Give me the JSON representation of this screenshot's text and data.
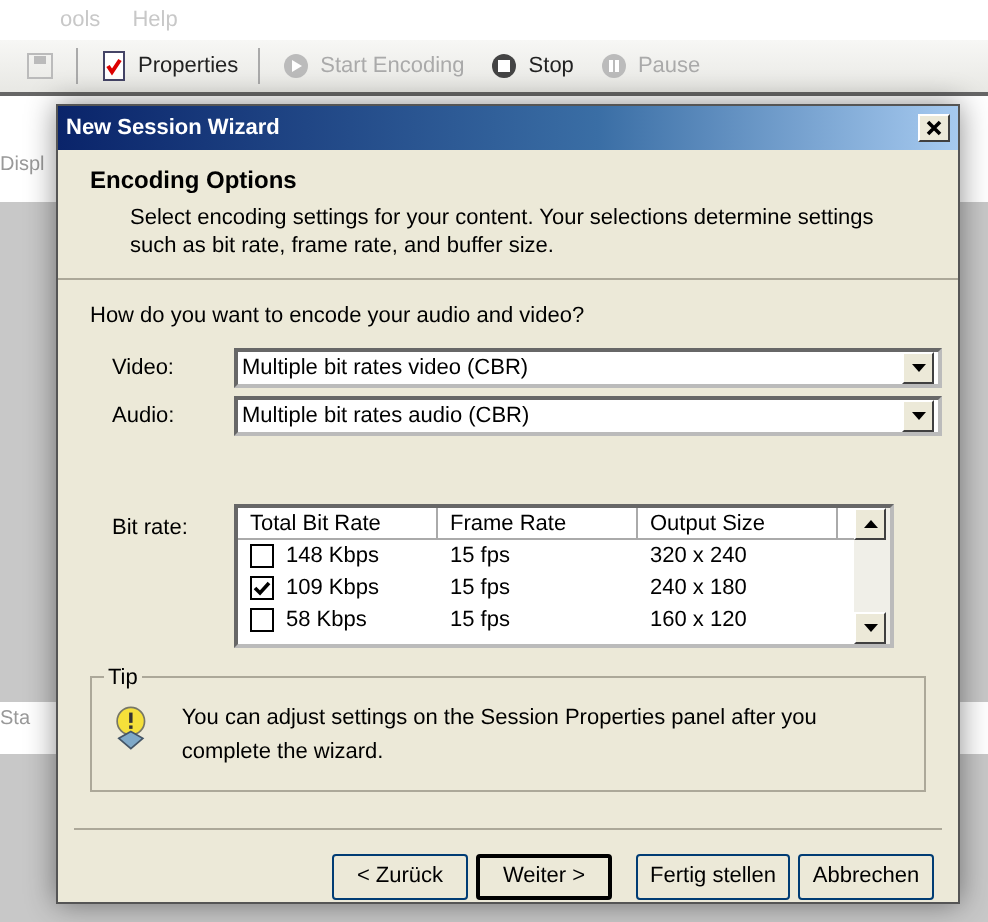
{
  "app": {
    "menu": [
      "ools",
      "Help"
    ],
    "toolbar": [
      {
        "kind": "save",
        "disabled": true
      },
      {
        "kind": "properties",
        "label": "Properties",
        "disabled": false
      },
      {
        "kind": "start",
        "label": "Start Encoding",
        "disabled": true
      },
      {
        "kind": "stop",
        "label": "Stop",
        "disabled": false
      },
      {
        "kind": "pause",
        "label": "Pause",
        "disabled": true
      }
    ],
    "side_labels": [
      "Displ",
      "Sta"
    ]
  },
  "dialog": {
    "title": "New Session Wizard",
    "header": {
      "title": "Encoding Options",
      "description": "Select encoding settings for your content. Your selections determine settings such as bit rate, frame rate, and buffer size."
    },
    "question": "How do you want to encode your audio and video?",
    "fields": [
      {
        "label": "Video:",
        "value": "Multiple bit rates video (CBR)"
      },
      {
        "label": "Audio:",
        "value": "Multiple bit rates audio (CBR)"
      }
    ],
    "bit_rate": {
      "label": "Bit rate:",
      "columns": [
        "Total Bit Rate",
        "Frame Rate",
        "Output Size"
      ],
      "rows": [
        {
          "checked": false,
          "bit_rate": "148 Kbps",
          "frame_rate": "15 fps",
          "output_size": "320 x 240"
        },
        {
          "checked": true,
          "bit_rate": "109 Kbps",
          "frame_rate": "15 fps",
          "output_size": "240 x 180"
        },
        {
          "checked": false,
          "bit_rate": "58 Kbps",
          "frame_rate": "15 fps",
          "output_size": "160 x 120"
        }
      ]
    },
    "tip": {
      "title": "Tip",
      "text": "You can adjust settings on the Session Properties panel after you complete the wizard."
    },
    "buttons": [
      {
        "label": "< Zurück",
        "default": false
      },
      {
        "label": "Weiter >",
        "default": true
      },
      {
        "label": "Fertig stellen",
        "default": false
      },
      {
        "label": "Abbrechen",
        "default": false
      }
    ]
  }
}
